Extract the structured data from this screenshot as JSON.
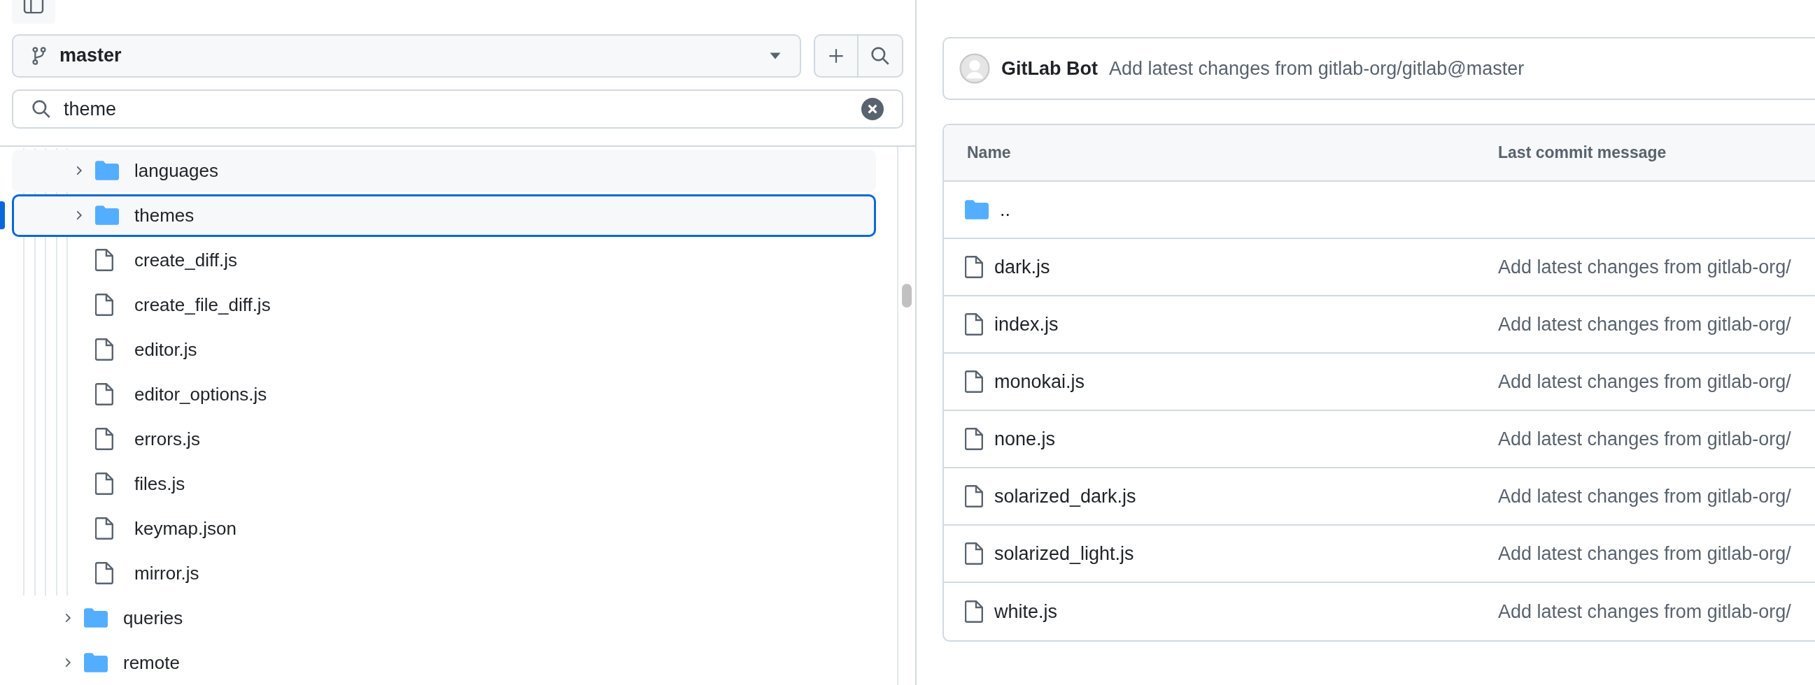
{
  "sidebar": {
    "branch": {
      "label": "master"
    },
    "search": {
      "value": "theme"
    },
    "tree": [
      {
        "kind": "group",
        "children": [
          {
            "kind": "folder",
            "name": "languages",
            "expanded": false,
            "selected": false
          },
          {
            "kind": "folder",
            "name": "themes",
            "expanded": false,
            "selected": true
          },
          {
            "kind": "file",
            "name": "create_diff.js",
            "selected": false
          },
          {
            "kind": "file",
            "name": "create_file_diff.js",
            "selected": false
          },
          {
            "kind": "file",
            "name": "editor.js",
            "selected": false
          },
          {
            "kind": "file",
            "name": "editor_options.js",
            "selected": false
          },
          {
            "kind": "file",
            "name": "errors.js",
            "selected": false
          },
          {
            "kind": "file",
            "name": "files.js",
            "selected": false
          },
          {
            "kind": "file",
            "name": "keymap.json",
            "selected": false
          },
          {
            "kind": "file",
            "name": "mirror.js",
            "selected": false
          }
        ]
      },
      {
        "kind": "folder",
        "name": "queries",
        "expanded": false,
        "selected": false
      },
      {
        "kind": "folder",
        "name": "remote",
        "expanded": false,
        "selected": false
      }
    ]
  },
  "commit": {
    "author": "GitLab Bot",
    "message": "Add latest changes from gitlab-org/gitlab@master"
  },
  "table": {
    "columns": [
      "Name",
      "Last commit message"
    ],
    "rows": [
      {
        "kind": "parent",
        "name": ".."
      },
      {
        "kind": "file",
        "name": "dark.js",
        "message": "Add latest changes from gitlab-org/"
      },
      {
        "kind": "file",
        "name": "index.js",
        "message": "Add latest changes from gitlab-org/"
      },
      {
        "kind": "file",
        "name": "monokai.js",
        "message": "Add latest changes from gitlab-org/"
      },
      {
        "kind": "file",
        "name": "none.js",
        "message": "Add latest changes from gitlab-org/"
      },
      {
        "kind": "file",
        "name": "solarized_dark.js",
        "message": "Add latest changes from gitlab-org/"
      },
      {
        "kind": "file",
        "name": "solarized_light.js",
        "message": "Add latest changes from gitlab-org/"
      },
      {
        "kind": "file",
        "name": "white.js",
        "message": "Add latest changes from gitlab-org/"
      }
    ]
  }
}
